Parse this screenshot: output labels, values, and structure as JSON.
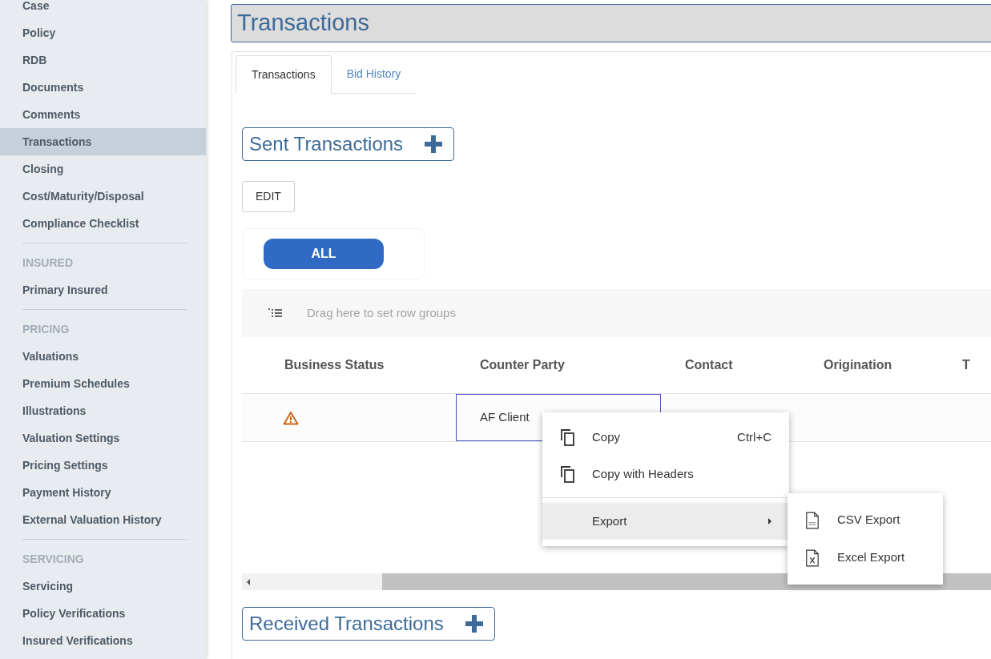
{
  "sidebar": {
    "groups": [
      {
        "items": [
          {
            "label": "Case",
            "selected": false
          },
          {
            "label": "Policy",
            "selected": false
          },
          {
            "label": "RDB",
            "selected": false
          },
          {
            "label": "Documents",
            "selected": false
          },
          {
            "label": "Comments",
            "selected": false
          },
          {
            "label": "Transactions",
            "selected": true
          },
          {
            "label": "Closing",
            "selected": false
          },
          {
            "label": "Cost/Maturity/Disposal",
            "selected": false
          },
          {
            "label": "Compliance Checklist",
            "selected": false
          }
        ]
      },
      {
        "heading": "INSURED",
        "items": [
          {
            "label": "Primary Insured",
            "selected": false
          }
        ]
      },
      {
        "heading": "PRICING",
        "items": [
          {
            "label": "Valuations",
            "selected": false
          },
          {
            "label": "Premium Schedules",
            "selected": false
          },
          {
            "label": "Illustrations",
            "selected": false
          },
          {
            "label": "Valuation Settings",
            "selected": false
          },
          {
            "label": "Pricing Settings",
            "selected": false
          },
          {
            "label": "Payment History",
            "selected": false
          },
          {
            "label": "External Valuation History",
            "selected": false
          }
        ]
      },
      {
        "heading": "SERVICING",
        "items": [
          {
            "label": "Servicing",
            "selected": false
          },
          {
            "label": "Policy Verifications",
            "selected": false
          },
          {
            "label": "Insured Verifications",
            "selected": false
          }
        ]
      }
    ]
  },
  "page_title": "Transactions",
  "tabs": [
    {
      "label": "Transactions",
      "selected": true
    },
    {
      "label": "Bid History",
      "selected": false
    }
  ],
  "sent_section": {
    "title": "Sent Transactions"
  },
  "edit_button": "EDIT",
  "filter_buttons": [
    {
      "label": "ALL",
      "selected": true
    }
  ],
  "row_group_bar": {
    "placeholder": "Drag here to set row groups"
  },
  "table": {
    "columns": [
      "Business Status",
      "Counter Party",
      "Contact",
      "Origination",
      "T"
    ],
    "rows": [
      {
        "warning": true,
        "counter_party": "AF Client",
        "counter_party_focused": true
      }
    ]
  },
  "context_menu": {
    "items": [
      {
        "kind": "item",
        "label": "Copy",
        "shortcut": "Ctrl+C"
      },
      {
        "kind": "item",
        "label": "Copy with Headers"
      },
      {
        "kind": "separator"
      },
      {
        "kind": "submenu",
        "label": "Export",
        "highlighted": true,
        "children": [
          {
            "label": "CSV Export"
          },
          {
            "label": "Excel Export"
          }
        ]
      }
    ]
  },
  "received_section": {
    "title": "Received Transactions"
  }
}
